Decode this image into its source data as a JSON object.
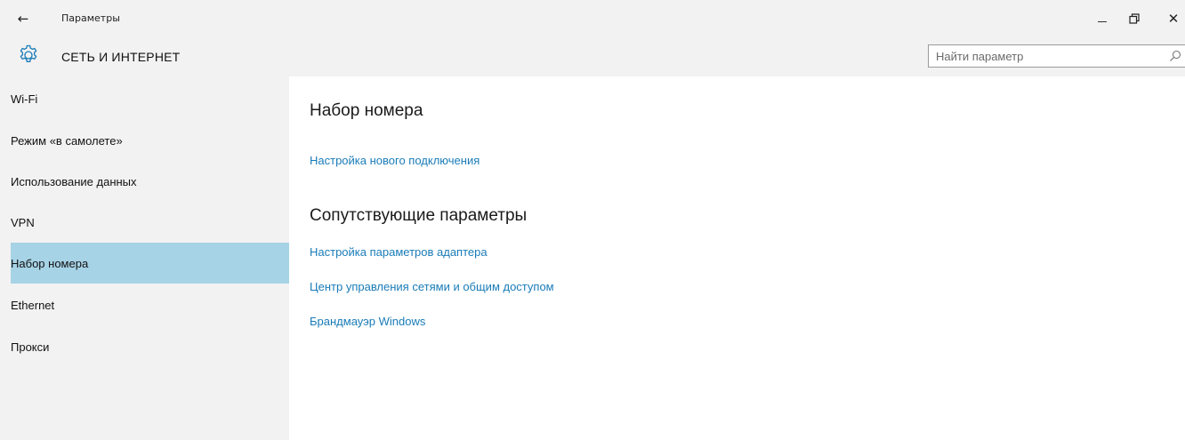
{
  "window": {
    "title": "Параметры",
    "controls": {
      "minimize_icon": "minimize-icon",
      "maximize_icon": "restore-icon",
      "close_icon": "close-icon",
      "close_glyph": "✕",
      "back_glyph": "←"
    }
  },
  "header": {
    "title": "СЕТЬ И ИНТЕРНЕТ",
    "icon": "gear-icon"
  },
  "search": {
    "placeholder": "Найти параметр",
    "value": ""
  },
  "sidebar": {
    "items": [
      {
        "label": "Wi-Fi",
        "selected": false
      },
      {
        "label": "Режим «в самолете»",
        "selected": false
      },
      {
        "label": "Использование данных",
        "selected": false
      },
      {
        "label": "VPN",
        "selected": false
      },
      {
        "label": "Набор номера",
        "selected": true
      },
      {
        "label": "Ethernet",
        "selected": false
      },
      {
        "label": "Прокси",
        "selected": false
      }
    ]
  },
  "main": {
    "section1": {
      "title": "Набор номера",
      "links": [
        "Настройка нового подключения"
      ]
    },
    "section2": {
      "title": "Сопутствующие параметры",
      "links": [
        "Настройка параметров адаптера",
        "Центр управления сетями и общим доступом",
        "Брандмауэр Windows"
      ]
    }
  },
  "colors": {
    "accent": "#1a7cb8",
    "selected_bg": "#a7d3e6",
    "chrome_bg": "#f2f2f2"
  }
}
